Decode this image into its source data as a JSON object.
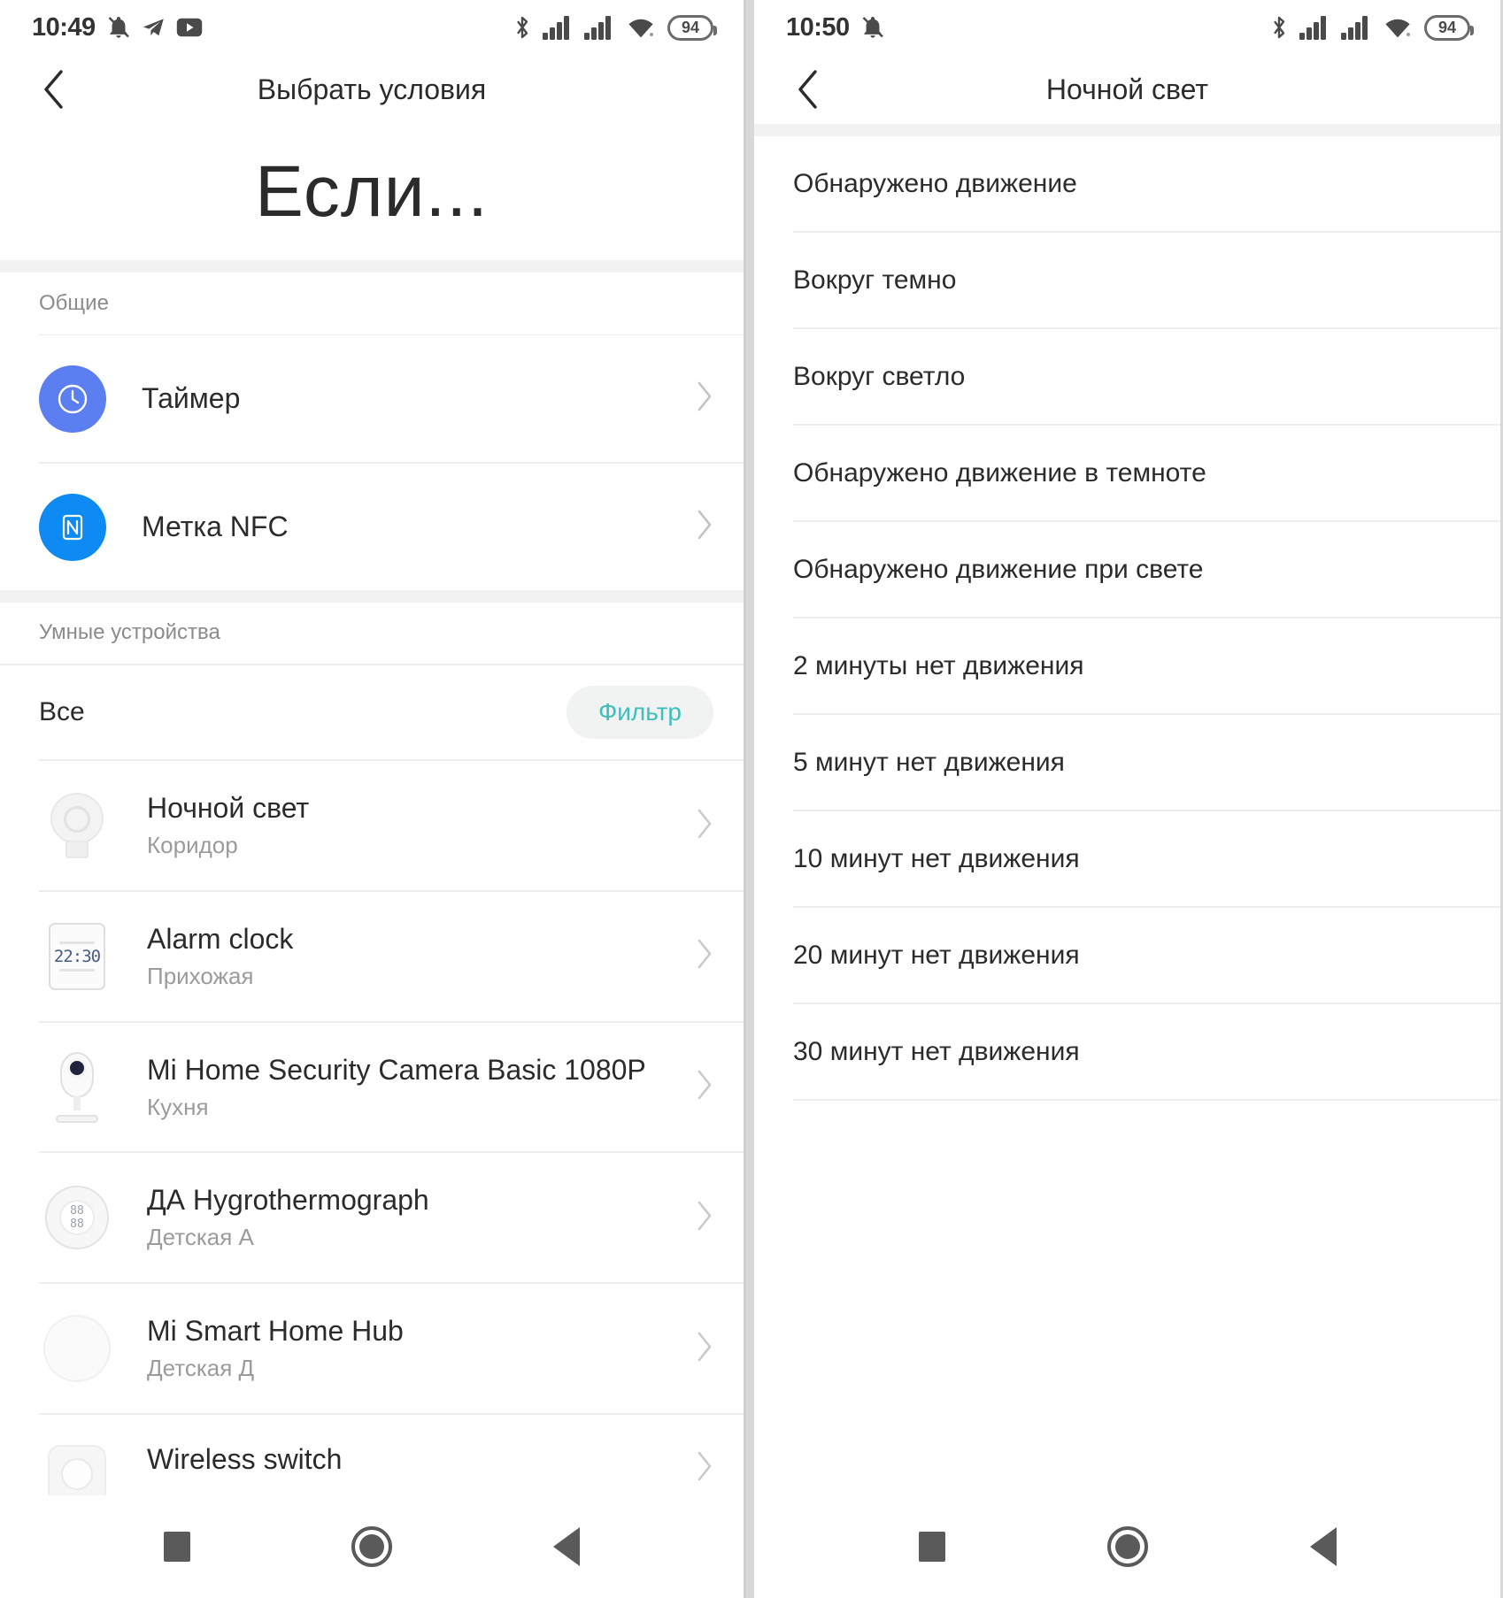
{
  "colors": {
    "accent_teal": "#3cbfbd",
    "timer_blue": "#5b7ef0",
    "nfc_blue": "#0d8bf2",
    "text_primary": "#2b2b2b",
    "text_secondary": "#9b9b9b",
    "divider": "#ededed",
    "band": "#f2f2f2"
  },
  "left_screen": {
    "statusbar": {
      "time": "10:49",
      "left_icons": [
        "mute-bell-icon",
        "telegram-icon",
        "youtube-icon"
      ],
      "right_icons": [
        "bluetooth-icon",
        "signal-sim1-icon",
        "signal-sim2-icon",
        "wifi-icon"
      ],
      "battery_percent": "94"
    },
    "appbar": {
      "back_icon": "chevron-left-icon",
      "title": "Выбрать условия"
    },
    "hero_title": "Если...",
    "sections": [
      {
        "header": "Общие",
        "items": [
          {
            "label": "Таймер",
            "icon": "clock-icon",
            "icon_bg": "#5b7ef0",
            "chevron": "chevron-right-icon"
          },
          {
            "label": "Метка NFC",
            "icon": "nfc-icon",
            "icon_bg": "#0d8bf2",
            "chevron": "chevron-right-icon"
          }
        ]
      }
    ],
    "devices_section": {
      "header": "Умные устройства",
      "all_label": "Все",
      "filter_label": "Фильтр",
      "devices": [
        {
          "name": "Ночной свет",
          "room": "Коридор",
          "art": "night-light-art"
        },
        {
          "name": "Alarm clock",
          "room": "Прихожая",
          "art": "alarm-clock-art",
          "lcd": "22:30"
        },
        {
          "name": "Mi Home Security Camera Basic 1080P",
          "room": "Кухня",
          "art": "camera-art"
        },
        {
          "name": "ДА Hygrothermograph",
          "room": "Детская А",
          "art": "hygrothermograph-art"
        },
        {
          "name": "Mi Smart Home Hub",
          "room": "Детская Д",
          "art": "hub-art"
        },
        {
          "name": "Wireless switch",
          "room": "",
          "art": "switch-art"
        }
      ]
    },
    "navbar": {
      "recents_icon": "square-icon",
      "home_icon": "circle-icon",
      "back_icon": "triangle-back-icon"
    }
  },
  "right_screen": {
    "statusbar": {
      "time": "10:50",
      "left_icons": [
        "mute-bell-icon"
      ],
      "right_icons": [
        "bluetooth-icon",
        "signal-sim1-icon",
        "signal-sim2-icon",
        "wifi-icon"
      ],
      "battery_percent": "94"
    },
    "appbar": {
      "back_icon": "chevron-left-icon",
      "title": "Ночной свет"
    },
    "conditions": [
      "Обнаружено движение",
      "Вокруг темно",
      "Вокруг светло",
      "Обнаружено движение в темноте",
      "Обнаружено движение при свете",
      "2 минуты нет движения",
      "5 минут нет движения",
      "10 минут нет движения",
      "20 минут нет движения",
      "30 минут нет движения"
    ],
    "navbar": {
      "recents_icon": "square-icon",
      "home_icon": "circle-icon",
      "back_icon": "triangle-back-icon"
    }
  }
}
